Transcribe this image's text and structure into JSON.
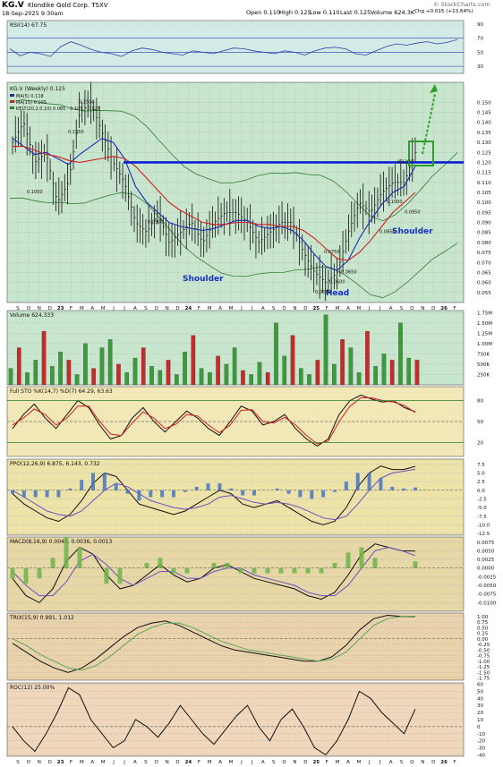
{
  "header": {
    "symbol": "KG.V",
    "company": "Klondike Gold Corp.  TSXV",
    "date": "18-Sep-2025 9:30am",
    "open": "Open 0.110",
    "high": "High 0.125",
    "low": "Low 0.110",
    "last": "Last 0.125",
    "volume": "Volume 624.3K",
    "change": "Chg +0.015 (+13.64%)",
    "credit": "© StockCharts.com"
  },
  "colors": {
    "price_bg": "#c8e6cd",
    "rsi_bg": "#d3ebe6",
    "sto_bg": "#f2e7b6",
    "ppo_bg": "#ede2a8",
    "macd_bg": "#e7d6a6",
    "trix_bg": "#ead3ab",
    "roc_bg": "#f0d6ba",
    "neckline": "#0b1fd6",
    "target": "#2ca02c",
    "annotation": "#1530c8"
  },
  "chart_data": [
    {
      "type": "line",
      "title": "RSI(14) 67.75",
      "series": [
        {
          "name": "RSI(14)",
          "values": [
            55,
            45,
            50,
            48,
            44,
            58,
            65,
            60,
            54,
            50,
            48,
            44,
            52,
            56,
            54,
            50,
            48,
            46,
            52,
            50,
            48,
            52,
            56,
            55,
            52,
            50,
            48,
            52,
            50,
            46,
            52,
            56,
            57,
            55,
            48,
            46,
            52,
            58,
            62,
            60,
            63,
            65,
            62,
            64,
            68
          ]
        }
      ],
      "hlines": [
        30,
        50,
        70
      ],
      "yticks": [
        "30",
        "50",
        "70",
        "90"
      ],
      "ylim": [
        20,
        95
      ]
    },
    {
      "type": "line",
      "title": "KG.V (Weekly) 0.125",
      "legend": [
        "MA(5) 0.118",
        "MA(15) 0.105",
        "KELT(20,2.0,10) 0.085 - 0.105 - 0.125"
      ],
      "x_tick_labels": [
        "S",
        "O",
        "N",
        "D",
        "23",
        "F",
        "M",
        "A",
        "M",
        "J",
        "J",
        "A",
        "S",
        "O",
        "N",
        "D",
        "24",
        "F",
        "M",
        "A",
        "M",
        "J",
        "J",
        "A",
        "S",
        "O",
        "N",
        "D",
        "25",
        "F",
        "M",
        "A",
        "M",
        "J",
        "J",
        "A",
        "S",
        "O",
        "N",
        "D",
        "26",
        "F"
      ],
      "yticks": [
        "0.055",
        "0.060",
        "0.065",
        "0.070",
        "0.075",
        "0.080",
        "0.085",
        "0.090",
        "0.095",
        "0.100",
        "0.105",
        "0.110",
        "0.115",
        "0.120",
        "0.125",
        "0.130",
        "0.135",
        "0.140",
        "0.145",
        "0.150"
      ],
      "ylim": [
        0.05,
        0.16
      ],
      "series": [
        {
          "name": "Close",
          "values": [
            0.13,
            0.14,
            0.12,
            0.125,
            0.1,
            0.11,
            0.145,
            0.15,
            0.135,
            0.12,
            0.11,
            0.09,
            0.085,
            0.095,
            0.08,
            0.085,
            0.09,
            0.08,
            0.09,
            0.095,
            0.095,
            0.09,
            0.08,
            0.085,
            0.09,
            0.09,
            0.075,
            0.065,
            0.06,
            0.065,
            0.085,
            0.1,
            0.095,
            0.105,
            0.11,
            0.11,
            0.125
          ]
        },
        {
          "name": "MA(5)",
          "values": [
            0.132,
            0.128,
            0.124,
            0.125,
            0.122,
            0.119,
            0.124,
            0.128,
            0.132,
            0.13,
            0.122,
            0.108,
            0.1,
            0.095,
            0.09,
            0.088,
            0.087,
            0.086,
            0.087,
            0.089,
            0.091,
            0.091,
            0.088,
            0.087,
            0.088,
            0.086,
            0.081,
            0.074,
            0.068,
            0.066,
            0.071,
            0.082,
            0.091,
            0.099,
            0.105,
            0.108,
            0.118
          ]
        },
        {
          "name": "MA(15)",
          "values": [
            0.128,
            0.128,
            0.126,
            0.124,
            0.123,
            0.121,
            0.12,
            0.121,
            0.122,
            0.123,
            0.122,
            0.118,
            0.112,
            0.106,
            0.1,
            0.096,
            0.093,
            0.09,
            0.089,
            0.089,
            0.09,
            0.09,
            0.089,
            0.089,
            0.088,
            0.088,
            0.086,
            0.082,
            0.077,
            0.072,
            0.071,
            0.075,
            0.081,
            0.088,
            0.095,
            0.1,
            0.105
          ]
        }
      ],
      "neckline": 0.12,
      "annotations": [
        "Shoulder",
        "Head",
        "Shoulder"
      ],
      "data_labels": [
        {
          "text": "0.1500",
          "value": 0.15
        },
        {
          "text": "0.1350",
          "value": 0.135
        },
        {
          "text": "0.1050",
          "value": 0.105
        },
        {
          "text": "0.0900",
          "value": 0.09
        },
        {
          "text": "0.1200",
          "value": 0.12
        },
        {
          "text": "0.1000",
          "value": 0.1
        },
        {
          "text": "0.0950",
          "value": 0.095
        },
        {
          "text": "0.0850",
          "value": 0.085
        },
        {
          "text": "0.0750",
          "value": 0.075
        },
        {
          "text": "0.0650",
          "value": 0.065
        },
        {
          "text": "0.0600",
          "value": 0.06
        },
        {
          "text": "0.0550",
          "value": 0.055
        }
      ]
    },
    {
      "type": "bar",
      "title": "Volume 624,333",
      "yticks": [
        "250K",
        "500K",
        "750K",
        "1.00M",
        "1.25M",
        "1.50M",
        "1.75M"
      ],
      "ylim": [
        0,
        1800000
      ],
      "values": [
        400000,
        900000,
        300000,
        600000,
        1300000,
        450000,
        800000,
        600000,
        250000,
        1000000,
        400000,
        900000,
        1100000,
        500000,
        300000,
        650000,
        900000,
        450000,
        350000,
        600000,
        250000,
        800000,
        1200000,
        400000,
        300000,
        700000,
        500000,
        900000,
        350000,
        250000,
        550000,
        300000,
        1500000,
        700000,
        1200000,
        400000,
        250000,
        600000,
        1700000,
        500000,
        1100000,
        900000,
        300000,
        1300000,
        450000,
        750000,
        600000,
        1500000,
        650000,
        600000
      ]
    },
    {
      "type": "line",
      "title": "Full STO %K(14,7) %D(7) 64.29, 63.63",
      "yticks": [
        "20",
        "50",
        "80"
      ],
      "ylim": [
        0,
        100
      ],
      "series": [
        {
          "name": "%K",
          "values": [
            40,
            60,
            75,
            55,
            40,
            60,
            80,
            70,
            45,
            25,
            30,
            55,
            70,
            50,
            35,
            50,
            65,
            55,
            40,
            30,
            50,
            72,
            65,
            45,
            50,
            60,
            40,
            25,
            15,
            25,
            60,
            80,
            88,
            82,
            78,
            80,
            70,
            64
          ]
        },
        {
          "name": "%D",
          "values": [
            45,
            55,
            68,
            60,
            45,
            55,
            72,
            72,
            50,
            32,
            30,
            48,
            64,
            55,
            40,
            46,
            60,
            58,
            45,
            34,
            45,
            66,
            67,
            50,
            48,
            56,
            45,
            30,
            18,
            22,
            50,
            72,
            84,
            84,
            80,
            78,
            73,
            63
          ]
        }
      ]
    },
    {
      "type": "line",
      "title": "PPO(12,26,9) 6.875, 6.143, 0.732",
      "yticks": [
        "-12.5",
        "-10.0",
        "-7.5",
        "-5.0",
        "-2.5",
        "0.0",
        "2.5",
        "5.0",
        "7.5"
      ],
      "ylim": [
        -13,
        9
      ],
      "series": [
        {
          "name": "PPO",
          "values": [
            -1,
            -4,
            -6,
            -8,
            -9,
            -7,
            -3,
            2,
            5,
            4,
            0,
            -4,
            -5,
            -6,
            -7,
            -6,
            -4,
            -2,
            0,
            -1,
            -4,
            -5,
            -4,
            -3,
            -5,
            -7,
            -9,
            -10,
            -9,
            -5,
            1,
            5,
            7,
            6,
            6,
            6.9
          ]
        },
        {
          "name": "Signal",
          "values": [
            0,
            -2,
            -4,
            -6,
            -7,
            -7.5,
            -6,
            -3,
            0,
            2,
            1,
            -1,
            -3,
            -4,
            -5,
            -5.5,
            -5,
            -4,
            -2,
            -1.5,
            -2.5,
            -3.5,
            -4,
            -3.5,
            -4,
            -5,
            -6.5,
            -8,
            -8.5,
            -7.5,
            -4,
            0,
            3.5,
            5,
            5.5,
            6.1
          ]
        }
      ]
    },
    {
      "type": "line",
      "title": "MACD(8,16,9) 0.0049, 0.0036, 0.0013",
      "yticks": [
        "-0.0100",
        "-0.0075",
        "-0.0050",
        "-0.0025",
        "0.0000",
        "0.0025",
        "0.0050",
        "0.0075"
      ],
      "ylim": [
        -0.0125,
        0.009
      ],
      "series": [
        {
          "name": "MACD",
          "values": [
            -0.003,
            -0.008,
            -0.01,
            -0.006,
            0.002,
            0.006,
            0.004,
            -0.002,
            -0.006,
            -0.005,
            -0.002,
            0.001,
            -0.002,
            -0.004,
            -0.003,
            0.0,
            0.001,
            -0.001,
            -0.003,
            -0.004,
            -0.005,
            -0.006,
            -0.008,
            -0.009,
            -0.007,
            -0.002,
            0.004,
            0.007,
            0.006,
            0.005,
            0.0049
          ]
        },
        {
          "name": "Signal",
          "values": [
            -0.001,
            -0.005,
            -0.008,
            -0.008,
            -0.004,
            0.002,
            0.004,
            0.001,
            -0.003,
            -0.005,
            -0.003,
            -0.001,
            -0.001,
            -0.003,
            -0.003,
            -0.001,
            0.0,
            0.0,
            -0.002,
            -0.003,
            -0.004,
            -0.005,
            -0.007,
            -0.008,
            -0.008,
            -0.005,
            0.0,
            0.005,
            0.006,
            0.005,
            0.0036
          ]
        }
      ]
    },
    {
      "type": "line",
      "title": "TRIX(15,9) 0.991, 1.012",
      "yticks": [
        "-1.75",
        "-1.50",
        "-1.25",
        "-1.00",
        "-0.75",
        "-0.50",
        "-0.25",
        "0.00",
        "0.25",
        "0.50",
        "0.75",
        "1.00"
      ],
      "ylim": [
        -1.85,
        1.15
      ],
      "series": [
        {
          "name": "TRIX",
          "values": [
            -0.2,
            -0.6,
            -1.0,
            -1.3,
            -1.5,
            -1.3,
            -0.9,
            -0.4,
            0.1,
            0.5,
            0.7,
            0.8,
            0.6,
            0.3,
            0.0,
            -0.3,
            -0.5,
            -0.6,
            -0.7,
            -0.8,
            -0.9,
            -1.0,
            -1.0,
            -0.8,
            -0.3,
            0.4,
            0.9,
            1.05,
            1.0,
            0.99
          ]
        },
        {
          "name": "Signal",
          "values": [
            0.0,
            -0.3,
            -0.7,
            -1.0,
            -1.3,
            -1.4,
            -1.2,
            -0.8,
            -0.3,
            0.2,
            0.5,
            0.7,
            0.7,
            0.5,
            0.2,
            -0.1,
            -0.3,
            -0.5,
            -0.6,
            -0.7,
            -0.8,
            -0.9,
            -1.0,
            -0.9,
            -0.6,
            0.0,
            0.6,
            0.9,
            1.0,
            1.012
          ]
        }
      ]
    },
    {
      "type": "line",
      "title": "ROC(12) 25.00%",
      "yticks": [
        "-40",
        "-30",
        "-20",
        "-10",
        "0",
        "10",
        "20",
        "30",
        "40",
        "50",
        "60"
      ],
      "ylim": [
        -42,
        62
      ],
      "series": [
        {
          "name": "ROC",
          "values": [
            0,
            -20,
            -35,
            -10,
            20,
            55,
            45,
            10,
            -10,
            -30,
            -20,
            10,
            0,
            -15,
            5,
            30,
            10,
            -10,
            -25,
            -5,
            15,
            30,
            0,
            -20,
            10,
            25,
            0,
            -30,
            -40,
            -20,
            10,
            50,
            40,
            20,
            5,
            -10,
            25
          ]
        }
      ]
    }
  ]
}
